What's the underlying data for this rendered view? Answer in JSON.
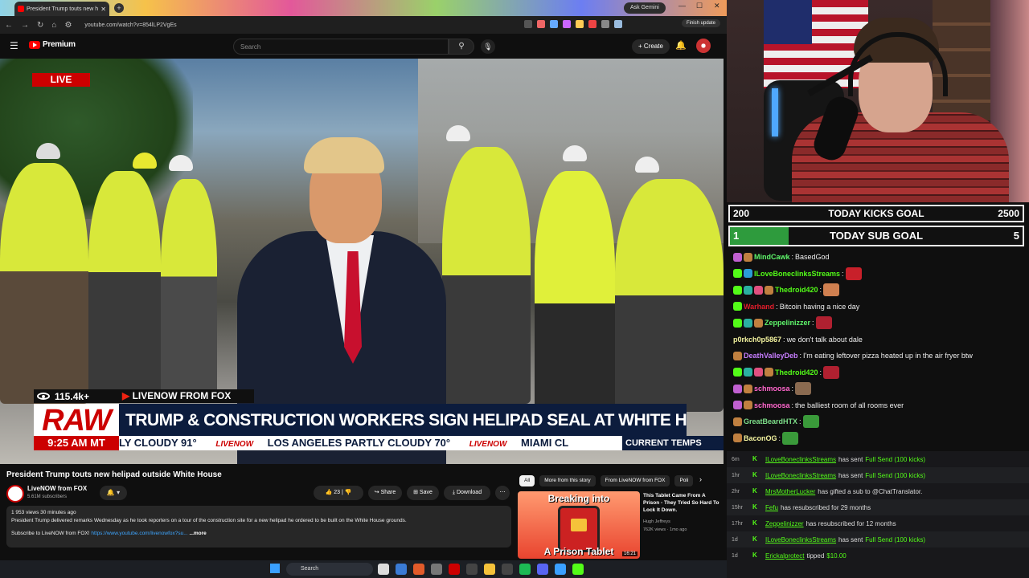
{
  "browser": {
    "tab_title": "President Trump touts new h",
    "ask_gemini": "Ask Gemini",
    "url": "youtube.com/watch?v=854lLP2VgEs",
    "finish_update": "Finish update"
  },
  "yt": {
    "logo_text": "Premium",
    "search_placeholder": "Search",
    "create_label": "+ Create"
  },
  "video": {
    "live_label": "LIVE",
    "viewers": "115.4k+",
    "source": "LIVENOW FROM FOX",
    "raw_label": "RAW",
    "headline": "TRUMP & CONSTRUCTION WORKERS SIGN HELIPAD SEAL AT WHITE HOUSE",
    "time": "9:25 AM MT",
    "ticker": [
      {
        "text": "LY  CLOUDY 91°"
      },
      {
        "text": "LOS ANGELES   PARTLY CLOUDY 70°"
      },
      {
        "text": "MIAMI   CL"
      }
    ],
    "ticker_brand": "LIVENOW",
    "current_temps": "CURRENT TEMPS"
  },
  "meta": {
    "title": "President Trump touts new helipad outside White House",
    "channel": "LiveNOW from FOX",
    "subs": "5.61M subscribers",
    "likes": "23",
    "share": "Share",
    "save": "Save",
    "download": "Download",
    "desc_stats": "1 953 views  30 minutes ago",
    "desc_text": "President Trump delivered remarks Wednesday as he took reporters on a tour of the construction site for a new helipad he ordered to be built on the White House grounds.",
    "desc_sub": "Subscribe to LiveNOW from FOX!",
    "desc_link": "https://www.youtube.com/livenowfox?su...",
    "desc_more": "...more"
  },
  "recs": {
    "chips": [
      "All",
      "More from this story",
      "From LiveNOW from FOX",
      "Poli"
    ],
    "item": {
      "thumb_top": "Breaking into",
      "thumb_bottom": "A Prison Tablet",
      "duration": "16:21",
      "title": "This Tablet Came From A Prison - They Tried So Hard To Lock It Down.",
      "channel": "Hugh Jeffreys",
      "stats": "762K views · 1mo ago"
    }
  },
  "taskbar": {
    "search": "Search"
  },
  "goals": {
    "kicks": {
      "low": "200",
      "name": "TODAY KICKS GOAL",
      "high": "2500",
      "progress": 0
    },
    "subs": {
      "low": "1",
      "name": "TODAY SUB GOAL",
      "high": "5",
      "progress": 0.2
    }
  },
  "chat": [
    {
      "user": "MindCawk",
      "color": "#5ef56a",
      "msg": "BasedGod",
      "badges": [
        "#c060d0",
        "#c08040"
      ],
      "emote": null
    },
    {
      "user": "ILoveBoneclinksStreams",
      "color": "#53fc18",
      "msg": "",
      "badges": [
        "#53fc18",
        "#2a9bd6"
      ],
      "emote": "#c8202a"
    },
    {
      "user": "Thedroid420",
      "color": "#53fc18",
      "msg": "",
      "badges": [
        "#53fc18",
        "#2ab0a0",
        "#e05080",
        "#c08040"
      ],
      "emote": "#d08050"
    },
    {
      "user": "Warhand",
      "color": "#e21d2b",
      "msg": "Bitcoin having a nice day",
      "badges": [
        "#53fc18"
      ],
      "emote": null
    },
    {
      "user": "Zeppelinizzer",
      "color": "#5ef56a",
      "msg": "",
      "badges": [
        "#53fc18",
        "#2ab0a0",
        "#c08040"
      ],
      "emote": "#b02030"
    },
    {
      "user": "p0rkch0p5867",
      "color": "#f5f5a0",
      "msg": "we don't talk about dale",
      "badges": [],
      "emote": null
    },
    {
      "user": "DeathValleyDeb",
      "color": "#c77dff",
      "msg": "I'm eating leftover pizza heated up in the air fryer btw",
      "badges": [
        "#c08040"
      ],
      "emote": null
    },
    {
      "user": "Thedroid420",
      "color": "#53fc18",
      "msg": "",
      "badges": [
        "#53fc18",
        "#2ab0a0",
        "#e05080",
        "#c08040"
      ],
      "emote": "#b02030"
    },
    {
      "user": "schmoosa",
      "color": "#ff66cc",
      "msg": "",
      "badges": [
        "#c060d0",
        "#c08040"
      ],
      "emote": "#8a6a50"
    },
    {
      "user": "schmoosa",
      "color": "#ff66cc",
      "msg": "the balliest room of all rooms ever",
      "badges": [
        "#c060d0",
        "#c08040"
      ],
      "emote": null
    },
    {
      "user": "GreatBeardHTX",
      "color": "#7ee08a",
      "msg": "",
      "badges": [
        "#c08040"
      ],
      "emote": "#3a9a3a"
    },
    {
      "user": "BaconOG",
      "color": "#f5f5a0",
      "msg": "",
      "badges": [
        "#c08040"
      ],
      "emote": "#3a9a3a"
    }
  ],
  "events": [
    {
      "ago": "6m",
      "who": "ILoveBoneclinksStreams",
      "text": "has sent",
      "hl": "Full Send (100 kicks)"
    },
    {
      "ago": "1hr",
      "who": "ILoveBoneclinksStreams",
      "text": "has sent",
      "hl": "Full Send (100 kicks)"
    },
    {
      "ago": "2hr",
      "who": "MrsMotherLucker",
      "text": "has gifted a sub to @ChatTranslator.",
      "hl": ""
    },
    {
      "ago": "15hr",
      "who": "Fefu",
      "text": "has resubscribed for 29 months",
      "hl": ""
    },
    {
      "ago": "17hr",
      "who": "Zeppelinizzer",
      "text": "has resubscribed for 12 months",
      "hl": ""
    },
    {
      "ago": "1d",
      "who": "ILoveBoneclinksStreams",
      "text": "has sent",
      "hl": "Full Send (100 kicks)"
    },
    {
      "ago": "1d",
      "who": "Erickalprotect",
      "text": "tipped",
      "hl": "$10.00"
    }
  ]
}
